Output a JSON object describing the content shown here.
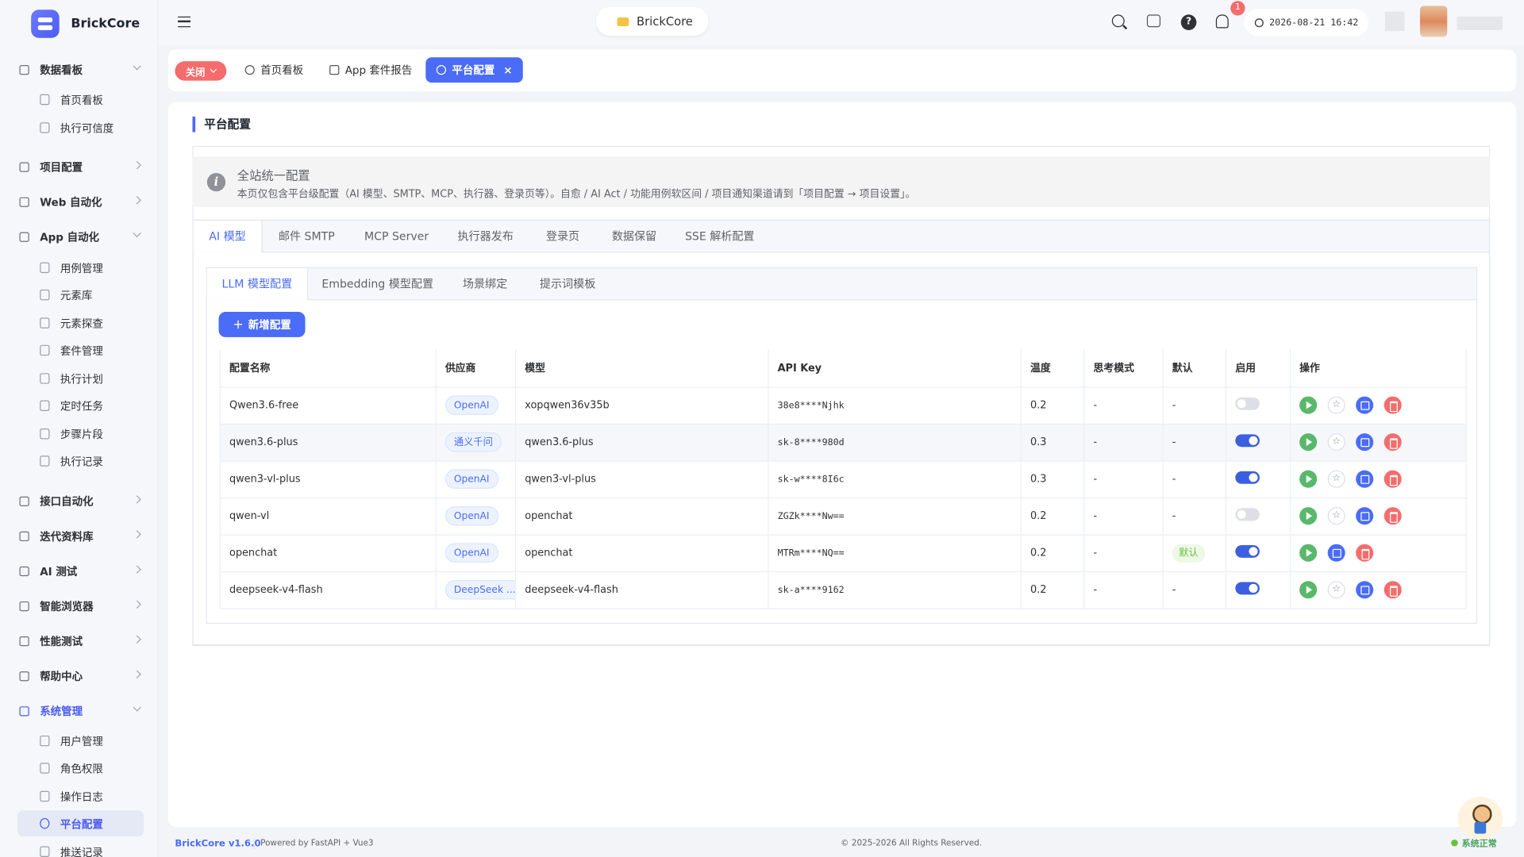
{
  "app": {
    "name": "BrickCore"
  },
  "topbar": {
    "project": "BrickCore",
    "datetime": "2026-08-21 16:42",
    "notification_count": "1",
    "help_glyph": "?",
    "icons": [
      "menu-toggle-icon",
      "search-icon",
      "printer-icon",
      "help-icon",
      "bell-icon",
      "clock-icon"
    ]
  },
  "sidebar": {
    "groups": [
      {
        "label": "数据看板",
        "open": true,
        "items": [
          "首页看板",
          "执行可信度"
        ]
      },
      {
        "label": "项目配置",
        "open": false,
        "items": []
      },
      {
        "label": "Web 自动化",
        "open": false,
        "items": []
      },
      {
        "label": "App 自动化",
        "open": true,
        "items": [
          "用例管理",
          "元素库",
          "元素探查",
          "套件管理",
          "执行计划",
          "定时任务",
          "步骤片段",
          "执行记录"
        ]
      },
      {
        "label": "接口自动化",
        "open": false,
        "items": []
      },
      {
        "label": "迭代资料库",
        "open": false,
        "items": []
      },
      {
        "label": "AI 测试",
        "open": false,
        "items": []
      },
      {
        "label": "智能浏览器",
        "open": false,
        "items": []
      },
      {
        "label": "性能测试",
        "open": false,
        "items": []
      },
      {
        "label": "帮助中心",
        "open": false,
        "items": []
      },
      {
        "label": "系统管理",
        "open": true,
        "active": true,
        "items": [
          "用户管理",
          "角色权限",
          "操作日志",
          "平台配置",
          "推送记录"
        ]
      }
    ],
    "active_item": "平台配置"
  },
  "tabbar": {
    "close_label": "关闭",
    "tabs": [
      {
        "label": "首页看板",
        "active": false
      },
      {
        "label": "App 套件报告",
        "active": false
      },
      {
        "label": "平台配置",
        "active": true
      }
    ],
    "close_glyph": "×"
  },
  "page": {
    "title": "平台配置",
    "info": {
      "title": "全站统一配置",
      "description": "本页仅包含平台级配置（AI 模型、SMTP、MCP、执行器、登录页等）。自愈 / AI Act / 功能用例软区间 / 项目通知渠道请到「项目配置 → 项目设置」。",
      "icon_glyph": "i"
    },
    "tabs": [
      "AI 模型",
      "邮件 SMTP",
      "MCP Server",
      "执行器发布",
      "登录页",
      "数据保留",
      "SSE 解析配置"
    ],
    "active_tab": "AI 模型",
    "subtabs": [
      "LLM 模型配置",
      "Embedding 模型配置",
      "场景绑定",
      "提示词模板"
    ],
    "active_subtab": "LLM 模型配置",
    "add_button": "新增配置",
    "add_glyph": "+"
  },
  "table": {
    "columns": [
      "配置名称",
      "供应商",
      "模型",
      "API Key",
      "温度",
      "思考模式",
      "默认",
      "启用",
      "操作"
    ],
    "rows": [
      {
        "name": "Qwen3.6-free",
        "provider": "OpenAI",
        "model": "xopqwen36v35b",
        "api_key": "38e8****Njhk",
        "temperature": "0.2",
        "thinking": "-",
        "default": "-",
        "enabled": false,
        "is_default": false
      },
      {
        "name": "qwen3.6-plus",
        "provider": "通义千问",
        "model": "qwen3.6-plus",
        "api_key": "sk-8****980d",
        "temperature": "0.3",
        "thinking": "-",
        "default": "-",
        "enabled": true,
        "is_default": false
      },
      {
        "name": "qwen3-vl-plus",
        "provider": "OpenAI",
        "model": "qwen3-vl-plus",
        "api_key": "sk-w****8I6c",
        "temperature": "0.3",
        "thinking": "-",
        "default": "-",
        "enabled": true,
        "is_default": false
      },
      {
        "name": "qwen-vl",
        "provider": "OpenAI",
        "model": "openchat",
        "api_key": "ZGZk****Nw==",
        "temperature": "0.2",
        "thinking": "-",
        "default": "-",
        "enabled": false,
        "is_default": false
      },
      {
        "name": "openchat",
        "provider": "OpenAI",
        "model": "openchat",
        "api_key": "MTRm****NQ==",
        "temperature": "0.2",
        "thinking": "-",
        "default": "默认",
        "enabled": true,
        "is_default": true
      },
      {
        "name": "deepseek-v4-flash",
        "provider": "DeepSeek ...",
        "model": "deepseek-v4-flash",
        "api_key": "sk-a****9162",
        "temperature": "0.2",
        "thinking": "-",
        "default": "-",
        "enabled": true,
        "is_default": false
      }
    ],
    "star_glyph": "☆"
  },
  "footer": {
    "version": "BrickCore v1.6.0",
    "powered": "Powered by FastAPI + Vue3",
    "copyright": "© 2025-2026 All Rights Reserved.",
    "status": "系统正常"
  },
  "colors": {
    "accent": "#4a6cf7",
    "danger": "#f56c6c",
    "success": "#59b86b"
  }
}
